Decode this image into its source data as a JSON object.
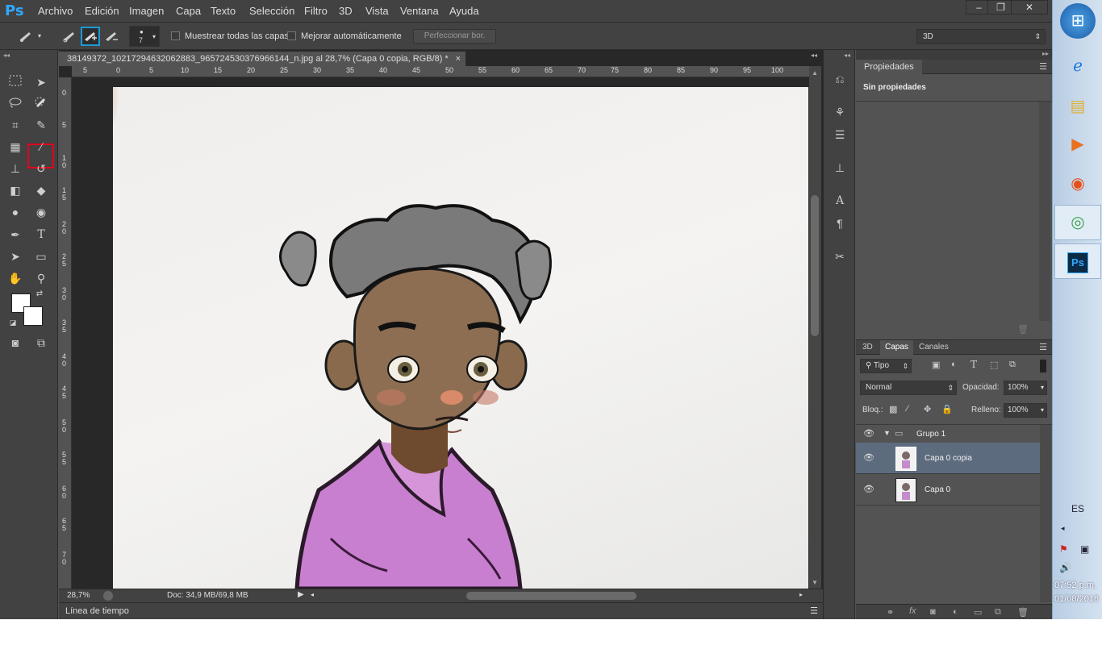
{
  "app": {
    "logo": "Ps"
  },
  "menu": [
    "Archivo",
    "Edición",
    "Imagen",
    "Capa",
    "Texto",
    "Selección",
    "Filtro",
    "3D",
    "Vista",
    "Ventana",
    "Ayuda"
  ],
  "window_buttons": {
    "minimize": "‒",
    "restore": "❐",
    "close": "✕"
  },
  "options": {
    "brush_size": "7",
    "sample_all_label": "Muestrear todas las capas",
    "auto_enhance_label": "Mejorar automáticamente",
    "refine_label": "Perfeccionar bor.",
    "workspace": "3D"
  },
  "document": {
    "tab_title": "38149372_10217294632062883_965724530376966144_n.jpg al 28,7% (Capa 0 copia, RGB/8) *",
    "tab_close": "×",
    "zoom": "28,7%",
    "doc_size": "Doc: 34,9 MB/69,8 MB",
    "ruler_top": [
      "5",
      "0",
      "5",
      "10",
      "15",
      "20",
      "25",
      "30",
      "35",
      "40",
      "45",
      "50",
      "55",
      "60",
      "65",
      "70",
      "75",
      "80",
      "85",
      "90",
      "95",
      "100"
    ],
    "ruler_left": [
      "0",
      "5",
      "1 0",
      "1 5",
      "2 0",
      "2 5",
      "3 0",
      "3 5",
      "4 0",
      "4 5",
      "5 0",
      "5 5",
      "6 0",
      "6 5",
      "7 0"
    ]
  },
  "timeline": {
    "label": "Línea de tiempo"
  },
  "properties": {
    "tab": "Propiedades",
    "content": "Sin propiedades"
  },
  "layers_panel": {
    "tabs": [
      "3D",
      "Capas",
      "Canales"
    ],
    "active_tab": "Capas",
    "filter_kind": "Tipo",
    "blend_mode": "Normal",
    "opacity_label": "Opacidad:",
    "opacity": "100%",
    "lock_label": "Bloq.:",
    "fill_label": "Relleno:",
    "fill": "100%",
    "layers": [
      {
        "name": "Grupo 1",
        "type": "group"
      },
      {
        "name": "Capa 0 copia",
        "type": "layer",
        "selected": true
      },
      {
        "name": "Capa 0",
        "type": "layer"
      }
    ]
  },
  "taskbar": {
    "language": "ES",
    "time": "07:52 p.m.",
    "date": "01/08/2018"
  }
}
